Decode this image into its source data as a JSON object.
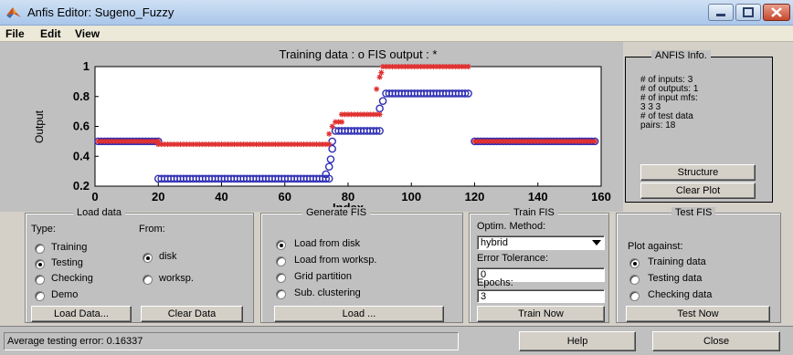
{
  "window": {
    "title": "Anfis Editor: Sugeno_Fuzzy"
  },
  "menu": {
    "items": [
      "File",
      "Edit",
      "View"
    ]
  },
  "chart_data": {
    "type": "scatter",
    "title": "Training data : o   FIS output : *",
    "xlabel": "Index",
    "ylabel": "Output",
    "xlim": [
      0,
      160
    ],
    "ylim": [
      0.2,
      1
    ],
    "xticks": [
      0,
      20,
      40,
      60,
      80,
      100,
      120,
      140,
      160
    ],
    "yticks": [
      0.2,
      0.4,
      0.6,
      0.8,
      1
    ],
    "yticklabels": [
      "0.2",
      "0.4",
      "0.6",
      "0.8",
      "1"
    ],
    "grid": false,
    "series": [
      {
        "marker": "o",
        "color": "#2f2fb4",
        "segments": [
          {
            "x_start": 1,
            "x_end": 20,
            "step": 1,
            "y": 0.5
          },
          {
            "x_start": 20,
            "x_end": 74,
            "step": 1,
            "y": 0.25
          },
          {
            "x_start": 76,
            "x_end": 90,
            "step": 1,
            "y": 0.57
          },
          {
            "x_start": 92,
            "x_end": 118,
            "step": 1,
            "y": 0.82
          },
          {
            "x_start": 120,
            "x_end": 158,
            "step": 1,
            "y": 0.5
          }
        ],
        "points": [
          [
            73,
            0.28
          ],
          [
            74,
            0.33
          ],
          [
            74.5,
            0.38
          ],
          [
            75,
            0.45
          ],
          [
            75,
            0.5
          ],
          [
            90,
            0.72
          ],
          [
            91,
            0.77
          ]
        ]
      },
      {
        "marker": "*",
        "color": "#e03030",
        "segments": [
          {
            "x_start": 1,
            "x_end": 20,
            "step": 1,
            "y": 0.5
          },
          {
            "x_start": 20,
            "x_end": 74,
            "step": 1,
            "y": 0.48
          },
          {
            "x_start": 76,
            "x_end": 78,
            "step": 1,
            "y": 0.63
          },
          {
            "x_start": 78,
            "x_end": 90,
            "step": 1,
            "y": 0.68
          },
          {
            "x_start": 91,
            "x_end": 118,
            "step": 1,
            "y": 1.0
          },
          {
            "x_start": 120,
            "x_end": 158,
            "step": 1,
            "y": 0.5
          }
        ],
        "points": [
          [
            74,
            0.55
          ],
          [
            75,
            0.6
          ],
          [
            89,
            0.85
          ],
          [
            90,
            0.93
          ],
          [
            90.5,
            0.96
          ]
        ]
      }
    ]
  },
  "anfis_info": {
    "title": "ANFIS Info.",
    "lines": [
      "# of inputs: 3",
      "# of outputs: 1",
      "# of input mfs:",
      "3 3 3",
      "# of test data",
      "pairs: 18"
    ],
    "structure_label": "Structure",
    "clear_plot_label": "Clear Plot"
  },
  "load_data": {
    "title": "Load data",
    "type_label": "Type:",
    "from_label": "From:",
    "types": [
      "Training",
      "Testing",
      "Checking",
      "Demo"
    ],
    "selected_type": "Testing",
    "sources": [
      "disk",
      "worksp."
    ],
    "selected_source": "disk",
    "load_button": "Load Data...",
    "clear_button": "Clear Data"
  },
  "generate_fis": {
    "title": "Generate FIS",
    "options": [
      "Load from disk",
      "Load from worksp.",
      "Grid partition",
      "Sub. clustering"
    ],
    "selected": "Load from disk",
    "load_button": "Load ..."
  },
  "train_fis": {
    "title": "Train FIS",
    "method_label": "Optim. Method:",
    "method_value": "hybrid",
    "tolerance_label": "Error Tolerance:",
    "tolerance_value": "0",
    "epochs_label": "Epochs:",
    "epochs_value": "3",
    "train_button": "Train Now"
  },
  "test_fis": {
    "title": "Test FIS",
    "plot_against_label": "Plot against:",
    "options": [
      "Training data",
      "Testing data",
      "Checking data"
    ],
    "selected": "Training data",
    "test_button": "Test Now"
  },
  "status": {
    "message": "Average testing error: 0.16337",
    "help_button": "Help",
    "close_button": "Close"
  }
}
